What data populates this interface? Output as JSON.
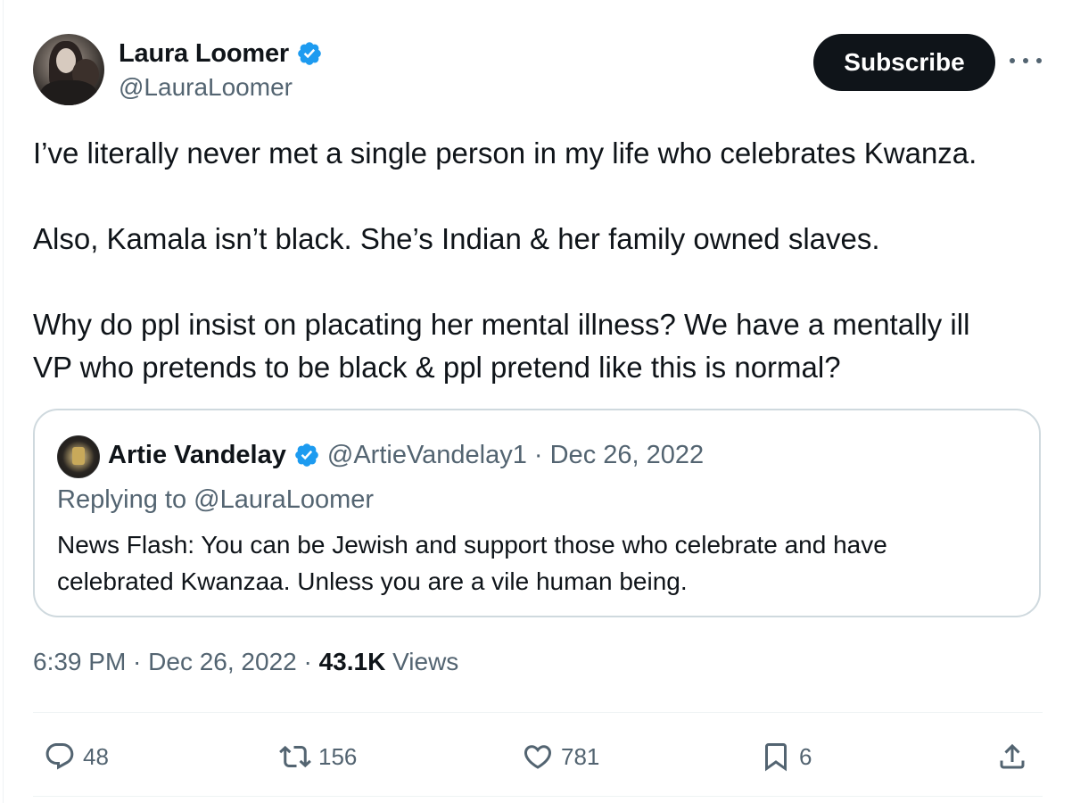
{
  "author": {
    "display_name": "Laura Loomer",
    "handle": "@LauraLoomer"
  },
  "subscribe_label": "Subscribe",
  "tweet": {
    "lines": [
      "I’ve literally never met a single  person in my life who celebrates Kwanza.",
      "Also, Kamala isn’t black. She’s Indian & her family owned slaves.",
      "Why do ppl insist on placating her mental illness? We have a mentally ill",
      "VP who pretends to be black & ppl pretend like this is normal?"
    ]
  },
  "quoted": {
    "display_name": "Artie Vandelay",
    "meta": "@ArtieVandelay1 · Dec 26, 2022",
    "replying_prefix": "Replying to ",
    "replying_to": "@LauraLoomer",
    "lines": [
      "News Flash:  You can be Jewish and support those who celebrate and have",
      "celebrated Kwanzaa.  Unless you are a vile human being."
    ]
  },
  "timestamp": {
    "time_date": "6:39 PM · Dec 26, 2022 · ",
    "views_count": "43.1K",
    "views_label": " Views"
  },
  "actions": {
    "replies": "48",
    "reposts": "156",
    "likes": "781",
    "bookmarks": "6"
  },
  "colors": {
    "verified_blue": "#1d9bf0",
    "text_primary": "#0f1419",
    "text_secondary": "#536471",
    "border": "#cfd9de"
  }
}
